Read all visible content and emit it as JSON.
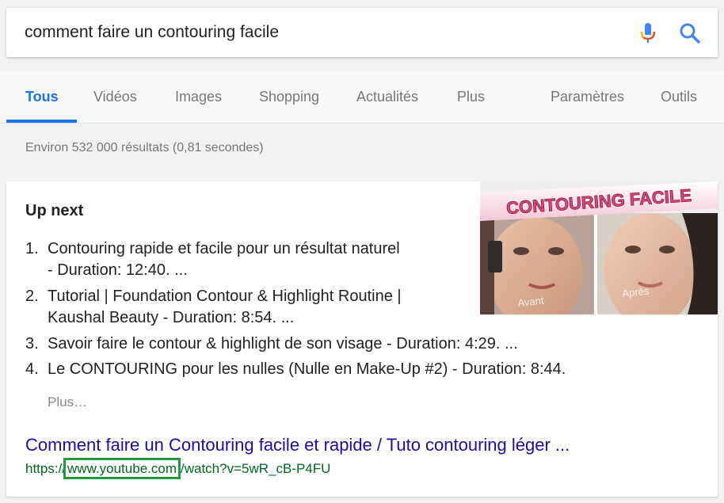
{
  "search": {
    "query": "comment faire un contouring facile"
  },
  "icons": {
    "mic": "microphone-icon",
    "search": "search-icon"
  },
  "tabs": [
    {
      "label": "Tous",
      "active": true
    },
    {
      "label": "Vidéos"
    },
    {
      "label": "Images"
    },
    {
      "label": "Shopping"
    },
    {
      "label": "Actualités"
    },
    {
      "label": "Plus"
    },
    {
      "label": "Paramètres"
    },
    {
      "label": "Outils"
    }
  ],
  "result_stats": "Environ 532 000 résultats (0,81 secondes)",
  "card": {
    "heading": "Up next",
    "items": [
      {
        "num": "1.",
        "line1": "Contouring rapide et facile pour un résultat naturel",
        "line2": "- Duration: 12:40. ..."
      },
      {
        "num": "2.",
        "line1": "Tutorial | Foundation Contour & Highlight Routine |",
        "line2": "Kaushal Beauty - Duration: 8:54. ..."
      },
      {
        "num": "3.",
        "line1": "Savoir faire le contour & highlight de son visage - Duration: 4:29. ..."
      },
      {
        "num": "4.",
        "line1": "Le CONTOURING pour les nulles (Nulle en Make-Up #2) - Duration: 8:44."
      }
    ],
    "more": "Plus…",
    "thumbnail": {
      "banner": "CONTOURING FACILE",
      "left_label": "Avant",
      "right_label": "Après"
    },
    "result": {
      "title": "Comment faire un Contouring facile et rapide / Tuto contouring léger ...",
      "url_prefix": "https://",
      "url_highlight": "www.youtube.com",
      "url_suffix": "/watch?v=5wR_cB-P4FU"
    }
  },
  "colors": {
    "accent": "#1a73e8",
    "link": "#1a0dab",
    "url": "#006621",
    "highlight_box": "#1e9c3c"
  }
}
